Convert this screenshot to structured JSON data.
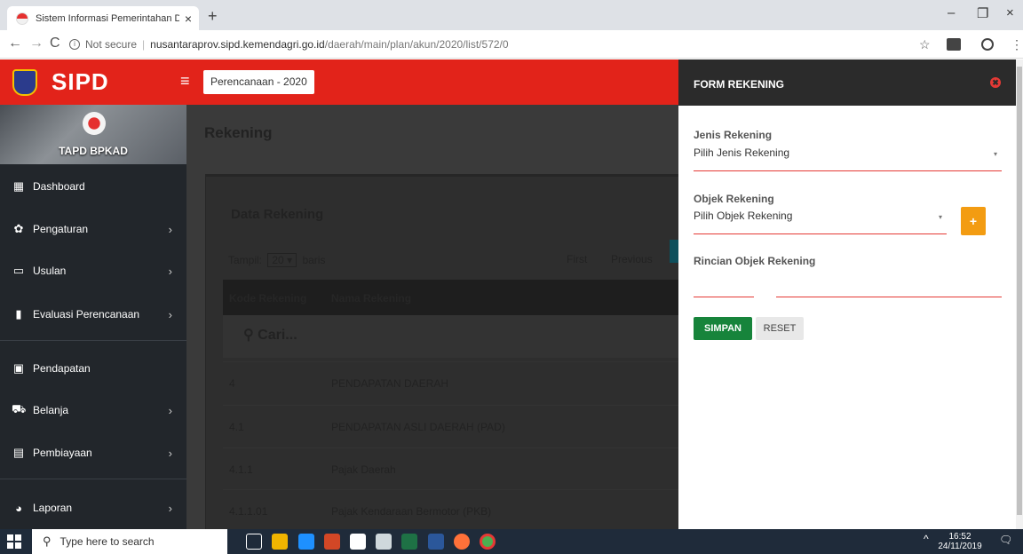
{
  "browser": {
    "tab_title": "Sistem Informasi Pemerintahan D",
    "tab_close": "×",
    "new_tab": "+",
    "minimize": "–",
    "restore": "❐",
    "close": "×",
    "back": "←",
    "forward": "→",
    "reload": "C",
    "security_label": "Not secure",
    "url_host": "nusantaraprov.sipd.kemendagri.go.id",
    "url_path": "/daerah/main/plan/akun/2020/list/572/0",
    "star": "☆",
    "menu": "⋮"
  },
  "app": {
    "brand": "SIPD",
    "breadcrumb": "Perencanaan - 2020",
    "profile_name": "TAPD BPKAD"
  },
  "sidebar": {
    "items": [
      {
        "label": "Dashboard",
        "icon": "▦",
        "chevron": ""
      },
      {
        "label": "Pengaturan",
        "icon": "✿",
        "chevron": "›"
      },
      {
        "label": "Usulan",
        "icon": "▭",
        "chevron": "›"
      },
      {
        "label": "Evaluasi Perencanaan",
        "icon": "▮",
        "chevron": "›"
      },
      {
        "label": "Pendapatan",
        "icon": "▣",
        "chevron": ""
      },
      {
        "label": "Belanja",
        "icon": "⛟",
        "chevron": "›"
      },
      {
        "label": "Pembiayaan",
        "icon": "▤",
        "chevron": "›"
      },
      {
        "label": "Laporan",
        "icon": "◕",
        "chevron": "›"
      }
    ]
  },
  "main": {
    "page_title": "Rekening",
    "panel_title": "Data Rekening",
    "show_label": "Tampil:",
    "show_value": "20",
    "show_caret": "▾",
    "show_suffix": "baris",
    "first": "First",
    "previous": "Previous",
    "col_code": "Kode Rekening",
    "col_name": "Nama Rekening",
    "search_placeholder": "Cari...",
    "search_icon": "⚲",
    "rows": [
      {
        "code": "4",
        "name": "PENDAPATAN DAERAH"
      },
      {
        "code": "4.1",
        "name": "PENDAPATAN ASLI DAERAH (PAD)"
      },
      {
        "code": "4.1.1",
        "name": "Pajak Daerah"
      },
      {
        "code": "4.1.1.01",
        "name": "Pajak Kendaraan Bermotor (PKB)"
      }
    ]
  },
  "form": {
    "title": "FORM REKENING",
    "close_glyph": "✖",
    "jenis_label": "Jenis Rekening",
    "jenis_value": "Pilih Jenis Rekening",
    "objek_label": "Objek Rekening",
    "objek_value": "Pilih Objek Rekening",
    "rincian_label": "Rincian Objek Rekening",
    "caret": "▾",
    "add_label": "+",
    "save_label": "SIMPAN",
    "reset_label": "RESET"
  },
  "taskbar": {
    "search_placeholder": "Type here to search",
    "search_icon": "⚲",
    "caret_up": "^",
    "time": "16:52",
    "date": "24/11/2019",
    "notif": "🗨"
  },
  "colors": {
    "appbar": "#e2231a",
    "sidebar": "#22262b",
    "save": "#17843b",
    "add": "#f39c12"
  }
}
